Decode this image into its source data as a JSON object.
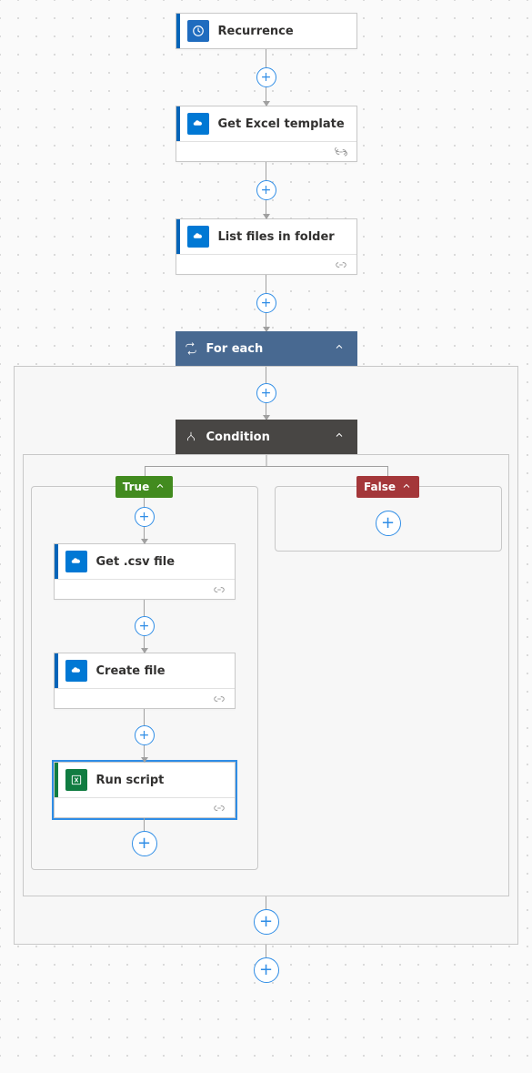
{
  "colors": {
    "blue_accent": "#0364B8",
    "onedrive_icon_bg": "#0078D4",
    "excel_icon_bg": "#107C41",
    "recurrence_icon_bg": "#1F6CBF",
    "foreach_bg": "#486991",
    "condition_bg": "#484644",
    "true_bg": "#428B1F",
    "false_bg": "#A4373A"
  },
  "steps": {
    "recurrence": {
      "label": "Recurrence"
    },
    "get_template": {
      "label": "Get Excel template"
    },
    "list_files": {
      "label": "List files in folder"
    }
  },
  "foreach": {
    "label": "For each",
    "condition": {
      "label": "Condition",
      "true_label": "True",
      "false_label": "False",
      "true_branch": {
        "get_csv": {
          "label": "Get .csv file"
        },
        "create_file": {
          "label": "Create file"
        },
        "run_script": {
          "label": "Run script"
        }
      }
    }
  }
}
